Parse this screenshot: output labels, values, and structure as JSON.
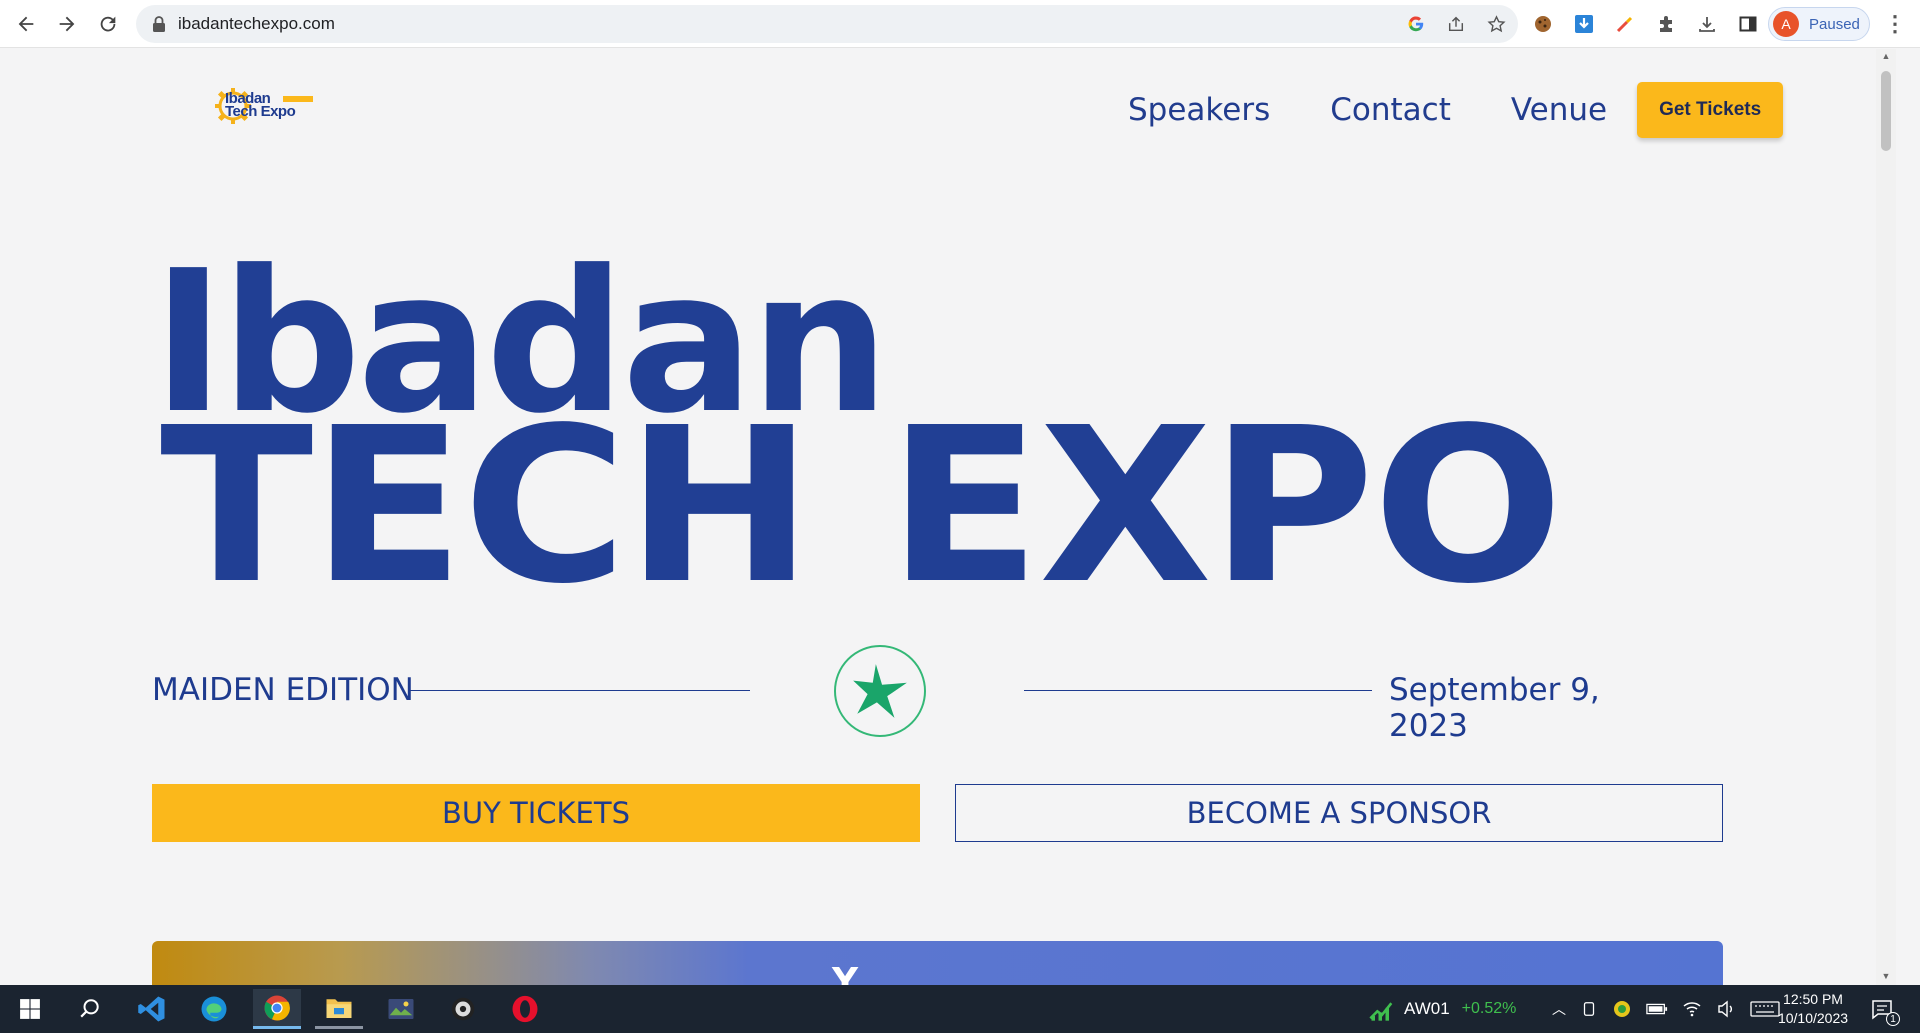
{
  "browser": {
    "url": "ibadantechexpo.com",
    "profile_initial": "A",
    "profile_status": "Paused"
  },
  "site": {
    "logo": {
      "line1": "Ibadan",
      "line2": "Tech Expo"
    },
    "nav": [
      "Speakers",
      "Contact",
      "Venue"
    ],
    "get_tickets": "Get Tickets",
    "hero_line1": "Ibadan",
    "hero_line2": "TECH EXPO",
    "edition": "MAIDEN EDITION",
    "date": "September 9, 2023",
    "buy_tickets": "BUY TICKETS",
    "become_sponsor": "BECOME A SPONSOR",
    "banner_peek": "Y"
  },
  "taskbar": {
    "stock_ticker": "AW01",
    "stock_change": "+0.52%",
    "time": "12:50 PM",
    "date": "10/10/2023",
    "notification_count": "1"
  },
  "colors": {
    "brand_blue": "#213f94",
    "brand_yellow": "#fbb81b",
    "star_green": "#1aa56a",
    "page_bg": "#f4f4f5"
  }
}
